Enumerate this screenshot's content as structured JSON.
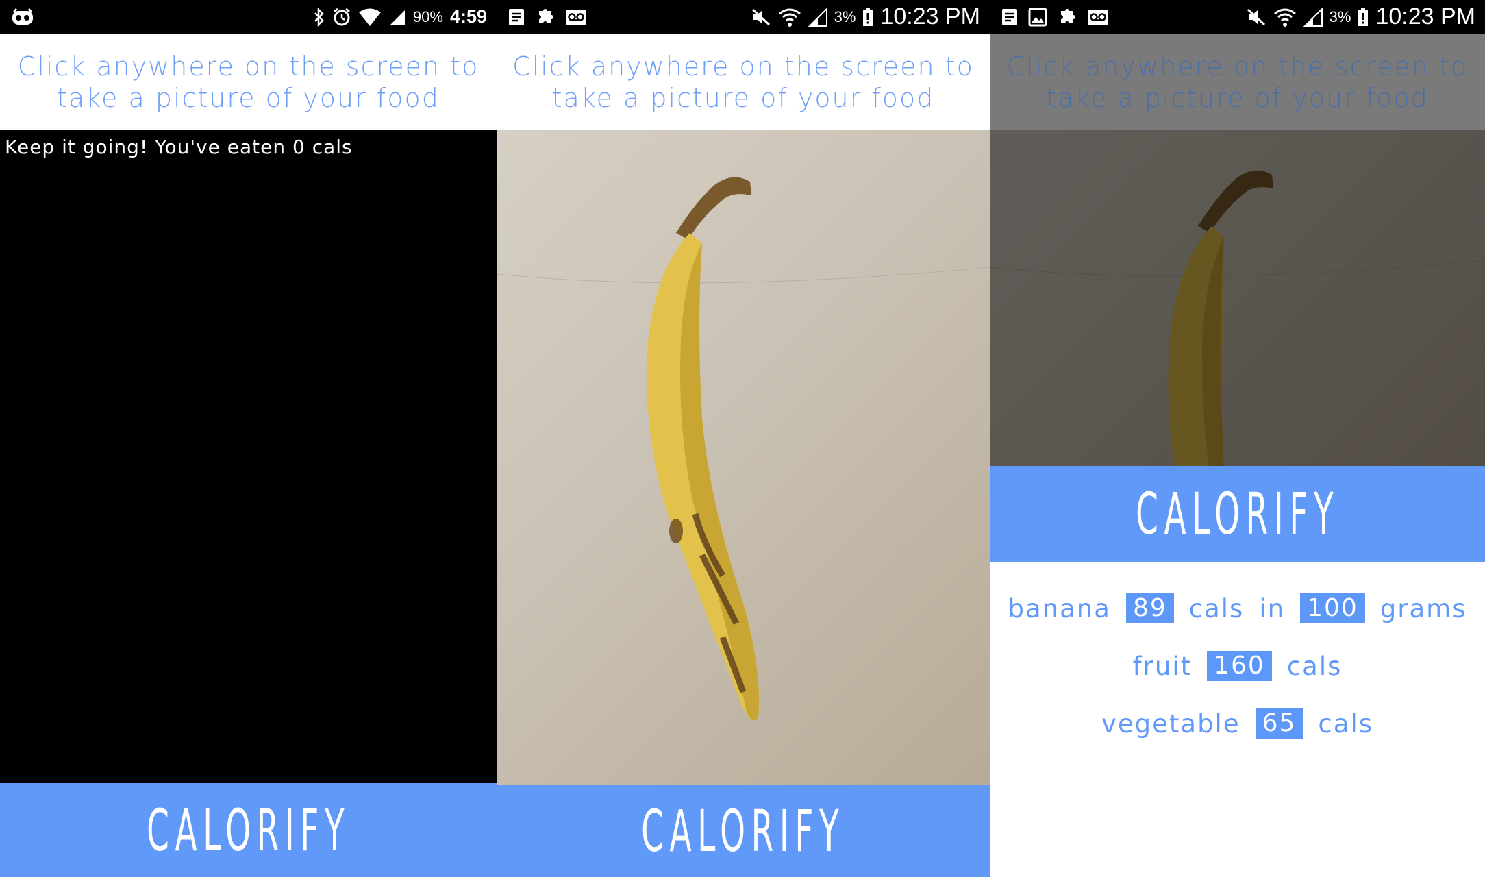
{
  "screens": [
    {
      "status_bar": {
        "battery": "90%",
        "time": "4:59"
      },
      "prompt": {
        "line1": "Click anywhere on the screen to",
        "line2": "take a picture of your food"
      },
      "camera": {
        "message": "Keep it going! You've eaten 0 cals"
      },
      "brand": "CALORIFY"
    },
    {
      "status_bar": {
        "battery": "3%",
        "time": "10:23 PM"
      },
      "prompt": {
        "line1": "Click anywhere on the screen to",
        "line2": "take a picture of your food"
      },
      "brand": "CALORIFY"
    },
    {
      "status_bar": {
        "battery": "3%",
        "time": "10:23 PM"
      },
      "prompt": {
        "line1": "Click anywhere on the screen to",
        "line2": "take a picture of your food"
      },
      "brand": "CALORIFY",
      "results": [
        {
          "name": "banana",
          "cals": "89",
          "cals_label": "cals",
          "in": "in",
          "grams": "100",
          "grams_label": "grams"
        },
        {
          "name": "fruit",
          "cals": "160",
          "cals_label": "cals"
        },
        {
          "name": "vegetable",
          "cals": "65",
          "cals_label": "cals"
        }
      ]
    }
  ],
  "colors": {
    "accent": "#6199f8",
    "prompt_text": "#6fa0f7",
    "status_bar": "#000000"
  }
}
